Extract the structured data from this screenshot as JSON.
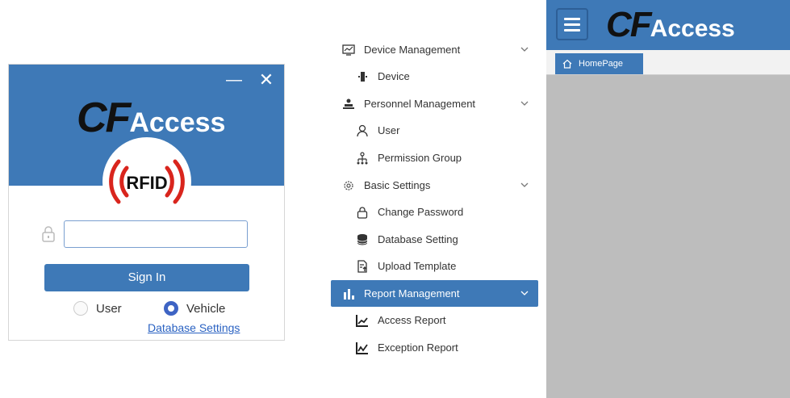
{
  "login": {
    "minimize_glyph": "—",
    "close_glyph": "✕",
    "logo_cf": "CF",
    "logo_access": "Access",
    "rfid_text": "RFID",
    "password_value": "",
    "signin_label": "Sign In",
    "radio_user_label": "User",
    "radio_vehicle_label": "Vehicle",
    "selected_mode": "Vehicle",
    "db_settings_link": "Database Settings"
  },
  "menu": {
    "device_management": "Device Management",
    "device": "Device",
    "personnel_management": "Personnel Management",
    "user": "User",
    "permission_group": "Permission Group",
    "basic_settings": "Basic Settings",
    "change_password": "Change Password",
    "database_setting": "Database Setting",
    "upload_template": "Upload Template",
    "report_management": "Report Management",
    "access_report": "Access Report",
    "exception_report": "Exception Report",
    "active_item": "Report Management"
  },
  "app": {
    "logo_cf": "CF",
    "logo_access": "Access",
    "home_tab": "HomePage"
  },
  "colors": {
    "brand_blue": "#3e79b7",
    "content_gray": "#bdbdbd",
    "rfid_red": "#d9251d",
    "link_blue": "#2a62c2"
  }
}
